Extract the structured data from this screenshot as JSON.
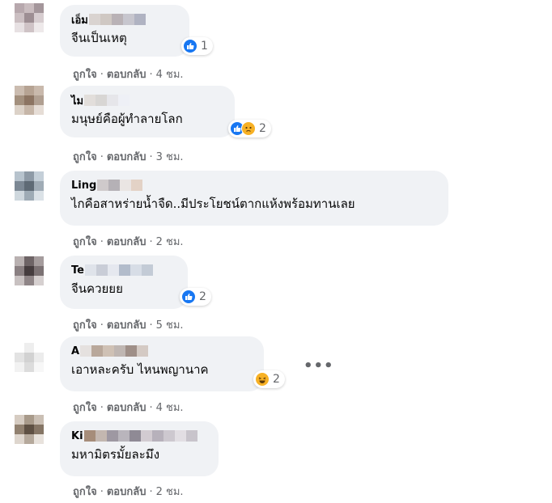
{
  "comments": [
    {
      "name": "เอ็ม",
      "text": "จีนเป็นเหตุ",
      "reaction_count": "1",
      "like": "ถูกใจ",
      "reply": "ตอบกลับ",
      "time": "4 ชม."
    },
    {
      "name": "ไม",
      "text": "มนุษย์คือผู้ทำลายโลก",
      "reaction_count": "2",
      "like": "ถูกใจ",
      "reply": "ตอบกลับ",
      "time": "3 ชม."
    },
    {
      "name": "Ling",
      "text": "ไกคือสาหร่ายน้ำจืด..มีประโยชน์ตากแห้งพร้อมทานเลย",
      "like": "ถูกใจ",
      "reply": "ตอบกลับ",
      "time": "2 ชม."
    },
    {
      "name": "Te",
      "text": "จีนควยยย",
      "reaction_count": "2",
      "like": "ถูกใจ",
      "reply": "ตอบกลับ",
      "time": "5 ชม."
    },
    {
      "name": "A",
      "text": "เอาหละครับ ไหนพญานาค",
      "reaction_count": "2",
      "like": "ถูกใจ",
      "reply": "ตอบกลับ",
      "time": "4 ชม."
    },
    {
      "name": "Ki",
      "text": "มหามิตรมั้ยละมึง",
      "like": "ถูกใจ",
      "reply": "ตอบกลับ",
      "time": "2 ชม."
    }
  ],
  "separator": "·",
  "more_options": "•••",
  "colors": {
    "bubble": "#f0f2f5",
    "meta_text": "#65676b",
    "like_blue": "#1877f2",
    "emoji_yellow": "#f7b125"
  },
  "icons": [
    "like-reaction-icon",
    "sad-reaction-icon",
    "haha-reaction-icon",
    "more-options-icon"
  ]
}
